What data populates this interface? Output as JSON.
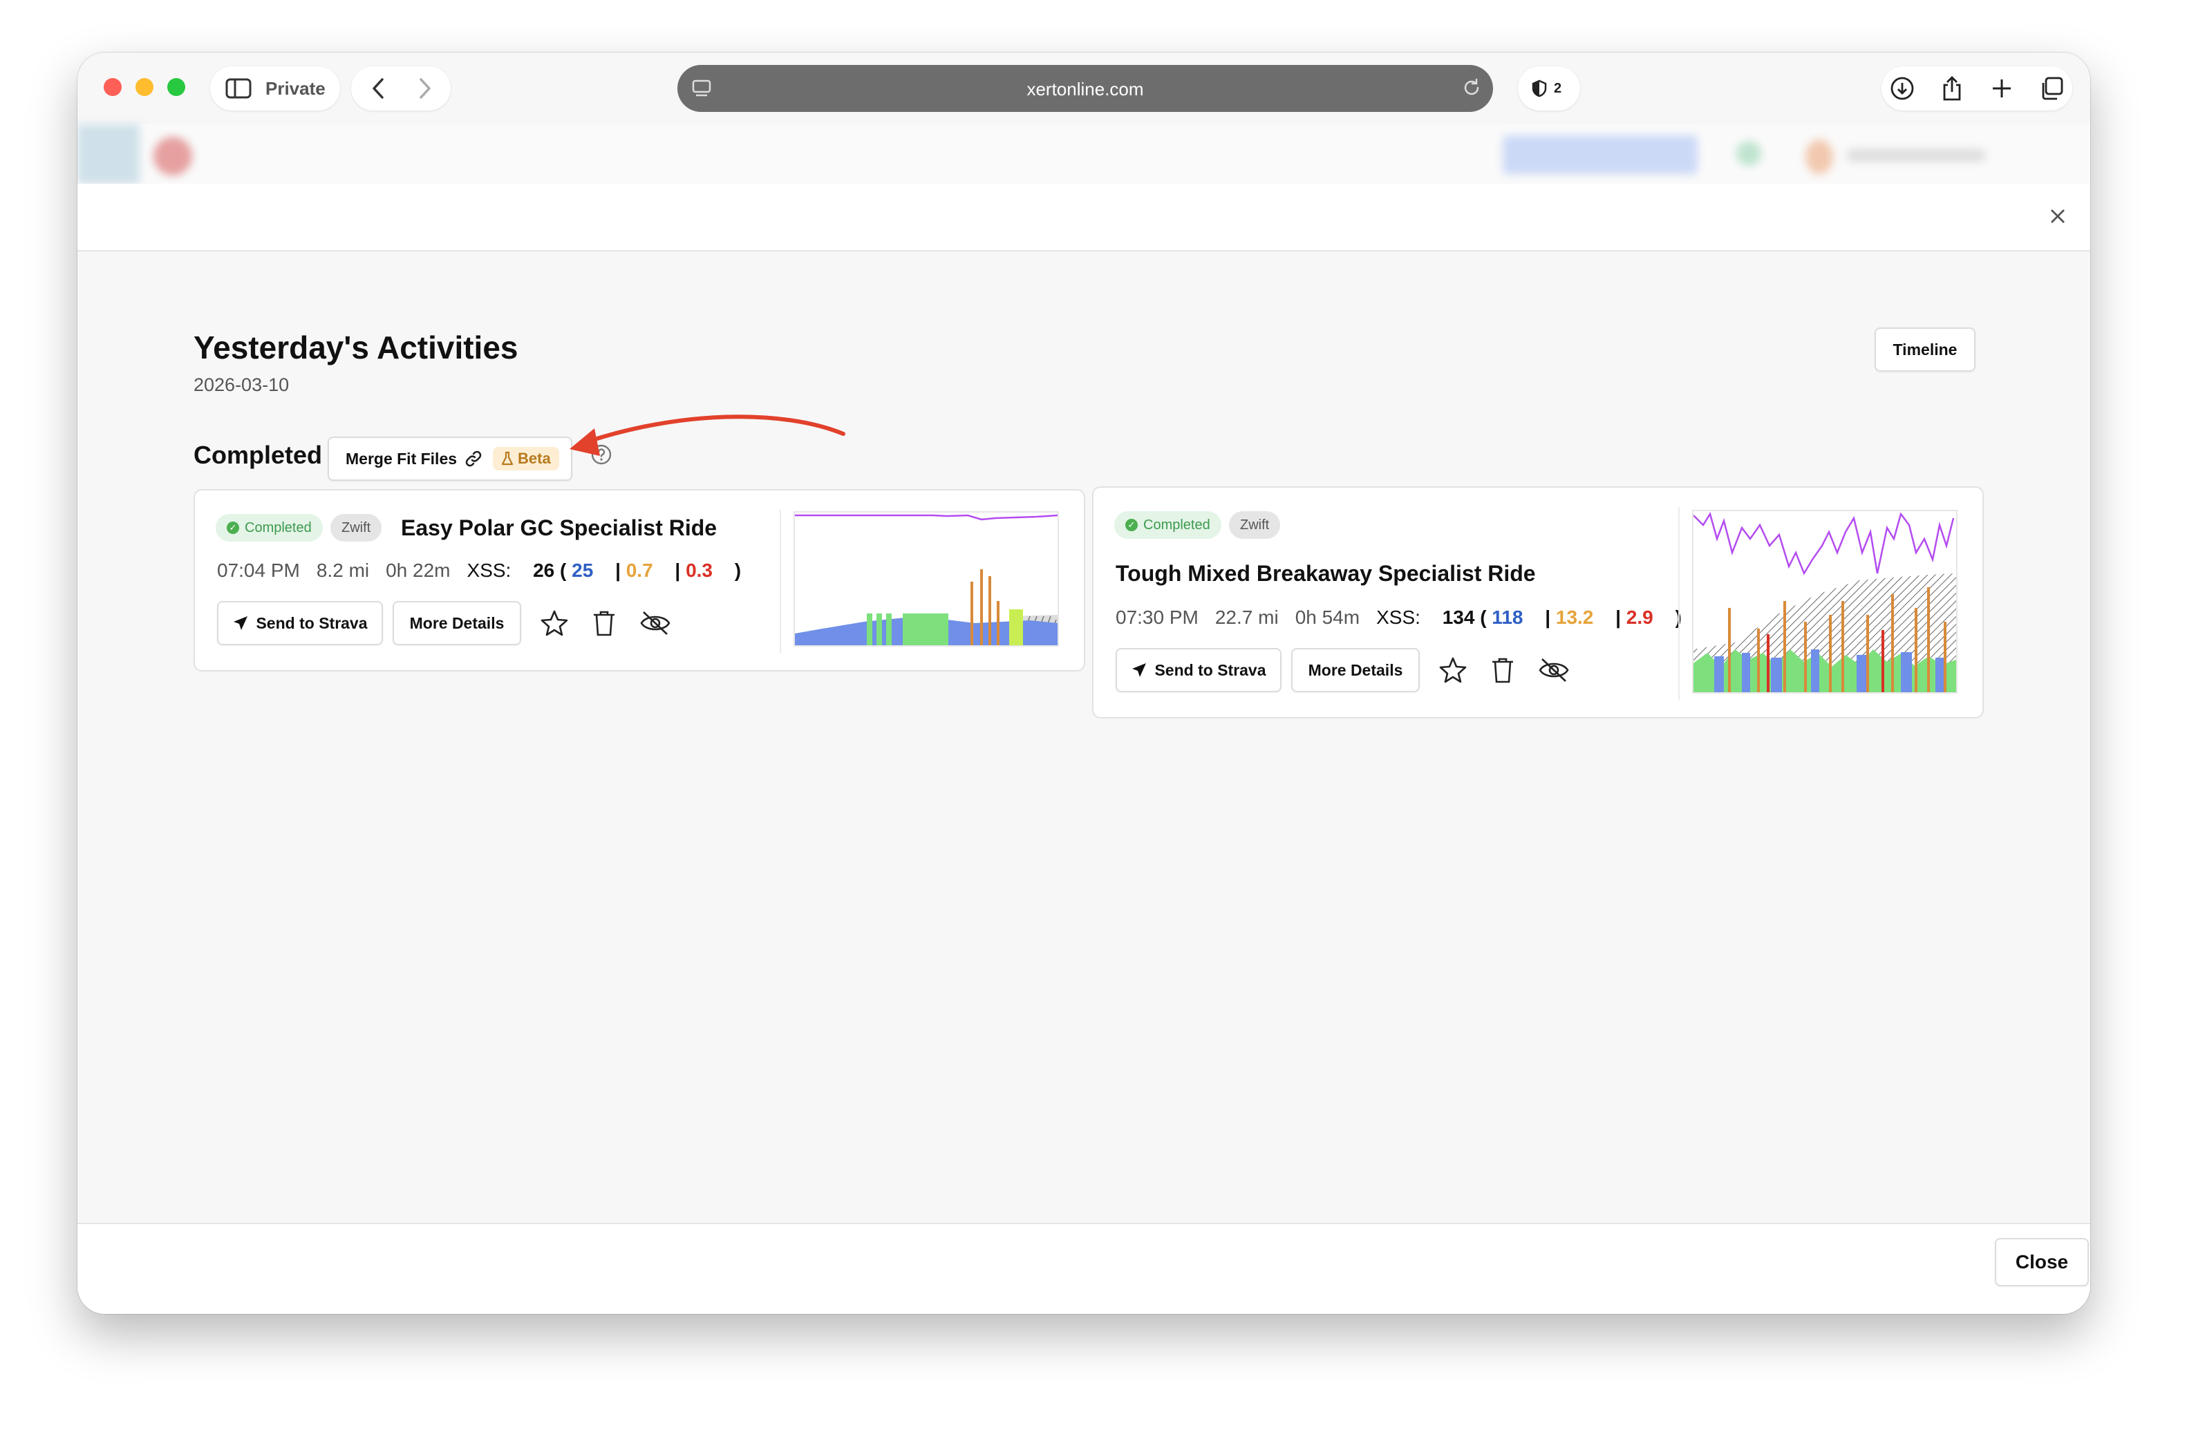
{
  "browser": {
    "private_label": "Private",
    "url": "xertonline.com",
    "shield_count": "2"
  },
  "modal": {
    "title": "Yesterday's Activities",
    "date": "2026-03-10",
    "timeline_label": "Timeline",
    "section_label": "Completed",
    "merge_label": "Merge Fit Files",
    "beta_label": "Beta",
    "close_label": "Close",
    "annotation_color": "#e2412b"
  },
  "activities": [
    {
      "status": "Completed",
      "source": "Zwift",
      "title": "Easy Polar GC Specialist Ride",
      "time": "07:04 PM",
      "distance": "8.2 mi",
      "duration": "0h 22m",
      "xss_label": "XSS:",
      "xss_total": "26",
      "xss_low": "25",
      "xss_high": "0.7",
      "xss_peak": "0.3",
      "send_label": "Send to Strava",
      "details_label": "More Details"
    },
    {
      "status": "Completed",
      "source": "Zwift",
      "title": "Tough Mixed Breakaway Specialist Ride",
      "time": "07:30 PM",
      "distance": "22.7 mi",
      "duration": "0h 54m",
      "xss_label": "XSS:",
      "xss_total": "134",
      "xss_low": "118",
      "xss_high": "13.2",
      "xss_peak": "2.9",
      "send_label": "Send to Strava",
      "details_label": "More Details"
    }
  ],
  "colors": {
    "xss_low": "#2f5fc4",
    "xss_high": "#e6a33a",
    "xss_peak": "#d93025",
    "completed_badge": "#3c9a4e",
    "power_line": "#b44cf0",
    "area_blue": "#6f8fe8",
    "area_green": "#7de07d",
    "spike_orange": "#d88a3a"
  }
}
